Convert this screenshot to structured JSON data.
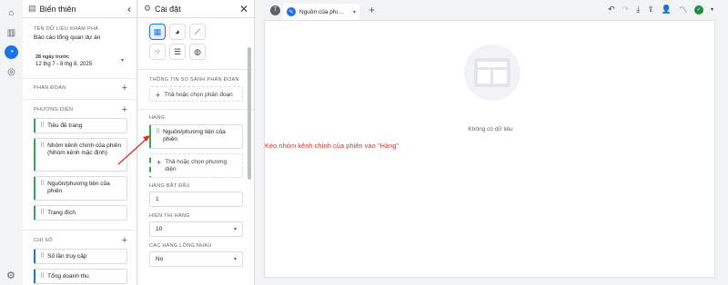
{
  "variables_panel": {
    "title": "Biến thiên",
    "exploration_name_label": "TÊN DỮ LIỆU KHÁM PHÁ",
    "exploration_name": "Báo cáo tổng quan dự án",
    "date_range_label": "28 ngày trước",
    "date_range": "12 thg 7 - 8 thg 8, 2025",
    "segments_label": "PHÂN ĐOẠN",
    "dimensions_label": "PHƯƠNG DIỆN",
    "dimensions": [
      "Tiêu đề trang",
      "Nhóm kênh chính của phiên (Nhóm kênh mặc định)",
      "Nguồn/phương tiện của phiên",
      "Trang đích"
    ],
    "metrics_label": "CHỈ SỐ",
    "metrics": [
      "Số lần truy cập",
      "Tổng doanh thu"
    ]
  },
  "settings_panel": {
    "title": "Cài đặt",
    "segment_comparison_label": "THÔNG TIN SO SÁNH PHÂN ĐOẠN",
    "segment_drop": "Thả hoặc chọn phân đoạn",
    "rows_label": "HÀNG",
    "rows_item": "Nguồn/phương tiện của phiên",
    "rows_drop": "Thả hoặc chọn phương diện",
    "start_row_label": "HÀNG BẮT ĐẦU",
    "start_row_value": "1",
    "show_rows_label": "HIỂN THỊ HÀNG",
    "show_rows_value": "10",
    "nested_rows_label": "CÁC HÀNG LỒNG NHAU",
    "nested_rows_value": "No"
  },
  "canvas": {
    "avatar_letter": "T",
    "tab_label": "Nguồn của phi…",
    "empty_text": "Không có dữ liệu",
    "annotation": "Kéo nhóm kênh chính của phiên vào \"Hàng\""
  },
  "colors": {
    "accent": "#1a73e8",
    "dimension_border": "#34a853",
    "metric_border": "#1a73e8",
    "annotation": "#d93025"
  }
}
